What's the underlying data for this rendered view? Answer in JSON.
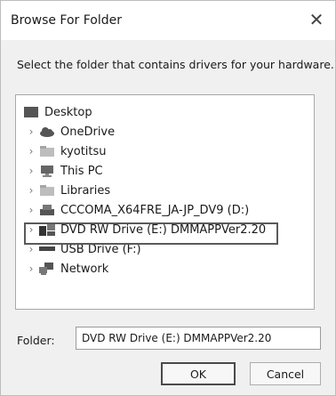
{
  "window": {
    "title": "Browse For Folder",
    "close_glyph": "✕"
  },
  "instruction": "Select the folder that contains drivers for your hardware.",
  "tree": {
    "items": [
      {
        "label": "Desktop",
        "icon": "desktop-icon",
        "expandable": false
      },
      {
        "label": "OneDrive",
        "icon": "cloud-icon",
        "expandable": true
      },
      {
        "label": "kyotitsu",
        "icon": "folder-icon",
        "expandable": true
      },
      {
        "label": "This PC",
        "icon": "computer-icon",
        "expandable": true
      },
      {
        "label": "Libraries",
        "icon": "folder-icon",
        "expandable": true
      },
      {
        "label": "CCCOMA_X64FRE_JA-JP_DV9 (D:)",
        "icon": "disc-drive-icon",
        "expandable": true
      },
      {
        "label": "DVD RW Drive (E:) DMMAPPVer2.20",
        "icon": "dvd-drive-icon",
        "expandable": true,
        "selected": true
      },
      {
        "label": "USB Drive (F:)",
        "icon": "usb-drive-icon",
        "expandable": true
      },
      {
        "label": "Network",
        "icon": "network-icon",
        "expandable": true
      }
    ],
    "chevron": "›"
  },
  "folder": {
    "label": "Folder:",
    "value": "DVD RW Drive (E:) DMMAPPVer2.20"
  },
  "buttons": {
    "ok": "OK",
    "cancel": "Cancel"
  }
}
